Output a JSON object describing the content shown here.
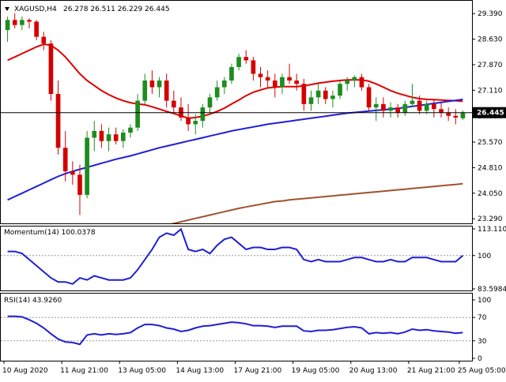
{
  "chart_data": [
    {
      "type": "candlestick",
      "title": "XAGUSD,H4",
      "ohlc_header": "26.278 26.511 26.229 26.445",
      "current_price": "26.445",
      "y_ticks": [
        "29.390",
        "28.630",
        "27.870",
        "27.110",
        "26.350",
        "25.570",
        "24.810",
        "24.050",
        "23.290"
      ],
      "ylim": [
        23.2,
        29.7
      ],
      "x_ticks": [
        "10 Aug 2020",
        "11 Aug 21:00",
        "13 Aug 05:00",
        "14 Aug 13:00",
        "17 Aug 21:00",
        "19 Aug 05:00",
        "20 Aug 13:00",
        "21 Aug 21:00",
        "25 Aug 05:00"
      ],
      "candles": [
        [
          28.9,
          29.3,
          28.55,
          29.2
        ],
        [
          29.2,
          29.4,
          28.95,
          29.05
        ],
        [
          29.05,
          29.3,
          28.9,
          29.2
        ],
        [
          29.2,
          29.25,
          28.95,
          29.15
        ],
        [
          29.15,
          29.2,
          28.6,
          28.7
        ],
        [
          28.7,
          28.85,
          28.3,
          28.5
        ],
        [
          28.5,
          28.6,
          26.8,
          27.0
        ],
        [
          27.0,
          27.4,
          25.2,
          25.4
        ],
        [
          25.4,
          25.9,
          24.4,
          24.7
        ],
        [
          24.7,
          25.0,
          24.3,
          24.6
        ],
        [
          24.6,
          24.9,
          23.4,
          24.0
        ],
        [
          24.0,
          25.9,
          23.9,
          25.7
        ],
        [
          25.7,
          26.2,
          25.3,
          25.9
        ],
        [
          25.9,
          26.1,
          25.4,
          25.6
        ],
        [
          25.6,
          26.0,
          25.3,
          25.8
        ],
        [
          25.8,
          26.0,
          25.5,
          25.6
        ],
        [
          25.6,
          25.95,
          25.4,
          25.85
        ],
        [
          25.85,
          26.1,
          25.7,
          26.0
        ],
        [
          26.0,
          27.0,
          25.9,
          26.8
        ],
        [
          26.8,
          27.6,
          26.7,
          27.4
        ],
        [
          27.4,
          27.7,
          27.0,
          27.2
        ],
        [
          27.2,
          27.5,
          26.9,
          27.4
        ],
        [
          27.4,
          27.6,
          26.6,
          26.8
        ],
        [
          26.8,
          27.1,
          26.4,
          26.6
        ],
        [
          26.6,
          26.9,
          26.2,
          26.3
        ],
        [
          26.3,
          26.7,
          25.9,
          26.1
        ],
        [
          26.1,
          26.4,
          25.8,
          26.2
        ],
        [
          26.2,
          26.7,
          26.0,
          26.6
        ],
        [
          26.6,
          27.0,
          26.4,
          26.9
        ],
        [
          26.9,
          27.4,
          26.8,
          27.2
        ],
        [
          27.2,
          27.5,
          27.0,
          27.4
        ],
        [
          27.4,
          27.9,
          27.3,
          27.8
        ],
        [
          27.8,
          28.2,
          27.7,
          28.1
        ],
        [
          28.1,
          28.3,
          27.9,
          28.0
        ],
        [
          28.0,
          28.1,
          27.4,
          27.6
        ],
        [
          27.6,
          27.8,
          27.2,
          27.5
        ],
        [
          27.5,
          27.7,
          27.2,
          27.4
        ],
        [
          27.4,
          27.6,
          26.9,
          27.2
        ],
        [
          27.2,
          27.6,
          27.0,
          27.5
        ],
        [
          27.5,
          27.9,
          27.3,
          27.4
        ],
        [
          27.4,
          27.6,
          27.1,
          27.3
        ],
        [
          27.3,
          27.45,
          26.5,
          26.7
        ],
        [
          26.7,
          27.1,
          26.5,
          26.9
        ],
        [
          26.9,
          27.3,
          26.7,
          27.1
        ],
        [
          27.1,
          27.2,
          26.7,
          26.85
        ],
        [
          26.85,
          27.1,
          26.6,
          26.95
        ],
        [
          26.95,
          27.4,
          26.85,
          27.3
        ],
        [
          27.3,
          27.5,
          27.1,
          27.4
        ],
        [
          27.4,
          27.55,
          27.2,
          27.5
        ],
        [
          27.5,
          27.6,
          27.1,
          27.2
        ],
        [
          27.2,
          27.3,
          26.5,
          26.6
        ],
        [
          26.6,
          26.9,
          26.2,
          26.7
        ],
        [
          26.7,
          26.9,
          26.3,
          26.5
        ],
        [
          26.5,
          26.75,
          26.3,
          26.6
        ],
        [
          26.6,
          26.7,
          26.3,
          26.45
        ],
        [
          26.45,
          26.8,
          26.35,
          26.7
        ],
        [
          26.7,
          27.3,
          26.6,
          26.8
        ],
        [
          26.8,
          26.95,
          26.4,
          26.5
        ],
        [
          26.5,
          26.8,
          26.4,
          26.7
        ],
        [
          26.7,
          26.85,
          26.3,
          26.55
        ],
        [
          26.55,
          26.75,
          26.3,
          26.45
        ],
        [
          26.45,
          26.6,
          26.2,
          26.35
        ],
        [
          26.35,
          26.55,
          26.1,
          26.3
        ],
        [
          26.278,
          26.511,
          26.229,
          26.445
        ]
      ],
      "series": [
        {
          "name": "",
          "color": "#e00000",
          "values": [
            28.0,
            28.1,
            28.2,
            28.3,
            28.4,
            28.48,
            28.45,
            28.3,
            28.1,
            27.85,
            27.6,
            27.4,
            27.25,
            27.1,
            26.98,
            26.88,
            26.8,
            26.74,
            26.7,
            26.68,
            26.62,
            26.55,
            26.48,
            26.42,
            26.35,
            26.28,
            26.3,
            26.34,
            26.4,
            26.48,
            26.58,
            26.7,
            26.82,
            26.95,
            27.05,
            27.12,
            27.18,
            27.2,
            27.22,
            27.22,
            27.22,
            27.24,
            27.28,
            27.32,
            27.35,
            27.38,
            27.4,
            27.42,
            27.42,
            27.42,
            27.38,
            27.3,
            27.2,
            27.1,
            27.02,
            26.96,
            26.9,
            26.86,
            26.84,
            26.83,
            26.82,
            26.81,
            26.8,
            26.78
          ]
        },
        {
          "name": "",
          "color": "#1f1fd6",
          "values": [
            23.85,
            23.95,
            24.05,
            24.15,
            24.25,
            24.35,
            24.45,
            24.55,
            24.63,
            24.7,
            24.76,
            24.82,
            24.88,
            24.94,
            25.0,
            25.06,
            25.11,
            25.16,
            25.22,
            25.28,
            25.34,
            25.4,
            25.45,
            25.5,
            25.55,
            25.6,
            25.65,
            25.7,
            25.75,
            25.8,
            25.85,
            25.9,
            25.94,
            25.98,
            26.02,
            26.06,
            26.1,
            26.13,
            26.16,
            26.19,
            26.22,
            26.25,
            26.28,
            26.31,
            26.34,
            26.37,
            26.4,
            26.43,
            26.45,
            26.47,
            26.49,
            26.51,
            26.53,
            26.55,
            26.57,
            26.6,
            26.63,
            26.66,
            26.69,
            26.72,
            26.75,
            26.78,
            26.81,
            26.84
          ]
        },
        {
          "name": "",
          "color": "#a0522d",
          "values": [
            22.0,
            22.05,
            22.1,
            22.15,
            22.2,
            22.25,
            22.3,
            22.35,
            22.4,
            22.45,
            22.5,
            22.55,
            22.6,
            22.65,
            22.7,
            22.75,
            22.8,
            22.85,
            22.9,
            22.95,
            23.0,
            23.05,
            23.1,
            23.15,
            23.2,
            23.25,
            23.3,
            23.35,
            23.4,
            23.45,
            23.5,
            23.55,
            23.6,
            23.64,
            23.68,
            23.72,
            23.76,
            23.8,
            23.82,
            23.85,
            23.87,
            23.89,
            23.91,
            23.93,
            23.95,
            23.97,
            23.99,
            24.01,
            24.03,
            24.05,
            24.07,
            24.09,
            24.11,
            24.13,
            24.15,
            24.17,
            24.19,
            24.21,
            24.23,
            24.25,
            24.27,
            24.29,
            24.31,
            24.33
          ]
        }
      ]
    },
    {
      "type": "line",
      "title": "Momentum(14) 100.0378",
      "y_ticks": [
        "113.1103",
        "100",
        "83.5984"
      ],
      "ylim": [
        83.5984,
        113.1103
      ],
      "reference_level": 100,
      "series": [
        {
          "name": "",
          "color": "#1f1fd6",
          "values": [
            102,
            102,
            101,
            98,
            95,
            92,
            89,
            87,
            87,
            86,
            89,
            88,
            90,
            89,
            88,
            88,
            88,
            89,
            93,
            98,
            103,
            109,
            111,
            110,
            113,
            103,
            102,
            103,
            101,
            105,
            108,
            109,
            106,
            103,
            104,
            104,
            103,
            103,
            104,
            104,
            103,
            98,
            97,
            98,
            97,
            97,
            97,
            98,
            99,
            99,
            98,
            97,
            97,
            98,
            97,
            97,
            99,
            99,
            99,
            98,
            97,
            97,
            97,
            100
          ]
        }
      ]
    },
    {
      "type": "line",
      "title": "RSI(14) 43.9260",
      "y_ticks": [
        "100",
        "70",
        "30",
        "0"
      ],
      "ylim": [
        0,
        100
      ],
      "levels": [
        70,
        30
      ],
      "series": [
        {
          "name": "",
          "color": "#1f1fd6",
          "values": [
            72,
            72,
            71,
            66,
            60,
            52,
            42,
            33,
            28,
            27,
            24,
            40,
            42,
            40,
            42,
            41,
            42,
            44,
            52,
            58,
            58,
            56,
            52,
            50,
            46,
            48,
            52,
            55,
            56,
            58,
            60,
            62,
            61,
            59,
            56,
            56,
            55,
            53,
            55,
            55,
            55,
            47,
            46,
            48,
            48,
            49,
            51,
            53,
            54,
            52,
            42,
            44,
            43,
            44,
            42,
            45,
            50,
            48,
            49,
            47,
            46,
            45,
            43,
            44
          ]
        }
      ]
    }
  ]
}
